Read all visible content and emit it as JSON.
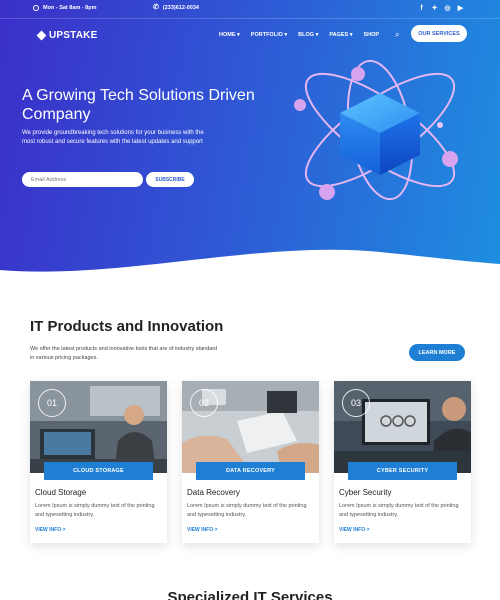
{
  "topbar": {
    "hours": "Mon - Sat 8am - 8pm",
    "phone": "(233)612-0034",
    "social": [
      "f",
      "t",
      "ig",
      "yt"
    ]
  },
  "nav": {
    "logo": "UPSTAKE",
    "items": [
      "HOME ▾",
      "PORTFOLIO ▾",
      "BLOG ▾",
      "PAGES ▾",
      "SHOP"
    ],
    "search_icon": "search-icon",
    "cta": "OUR SERVICES"
  },
  "hero": {
    "title": "A Growing Tech Solutions Driven Company",
    "description": "We provide groundbreaking tech solutions for your business with the most robust and secure features with the latest updates and support",
    "email_placeholder": "Email Address",
    "subscribe": "SUBSCRIBE"
  },
  "products": {
    "title": "IT Products and Innovation",
    "description": "We offer the latest products and innovative tools that are of industry standard in various pricing packages.",
    "learn_more": "LEARN MORE",
    "cards": [
      {
        "num": "01",
        "tag": "CLOUD STORAGE",
        "title": "Cloud Storage",
        "text": "Lorem Ipsum is simply dummy text of the printing and typesetting industry.",
        "link": "VIEW INFO >"
      },
      {
        "num": "02",
        "tag": "DATA RECOVERY",
        "title": "Data Recovery",
        "text": "Lorem Ipsum is simply dummy text of the printing and typesetting industry.",
        "link": "VIEW INFO >"
      },
      {
        "num": "03",
        "tag": "CYBER SECURITY",
        "title": "Cyber Security",
        "text": "Lorem Ipsum is simply dummy text of the printing and typesetting industry.",
        "link": "VIEW INFO >"
      }
    ]
  },
  "next_section": {
    "title": "Specialized IT Services"
  },
  "colors": {
    "accent": "#1f7fd4",
    "hero_start": "#3b2fc9",
    "hero_end": "#1e8fe0"
  }
}
